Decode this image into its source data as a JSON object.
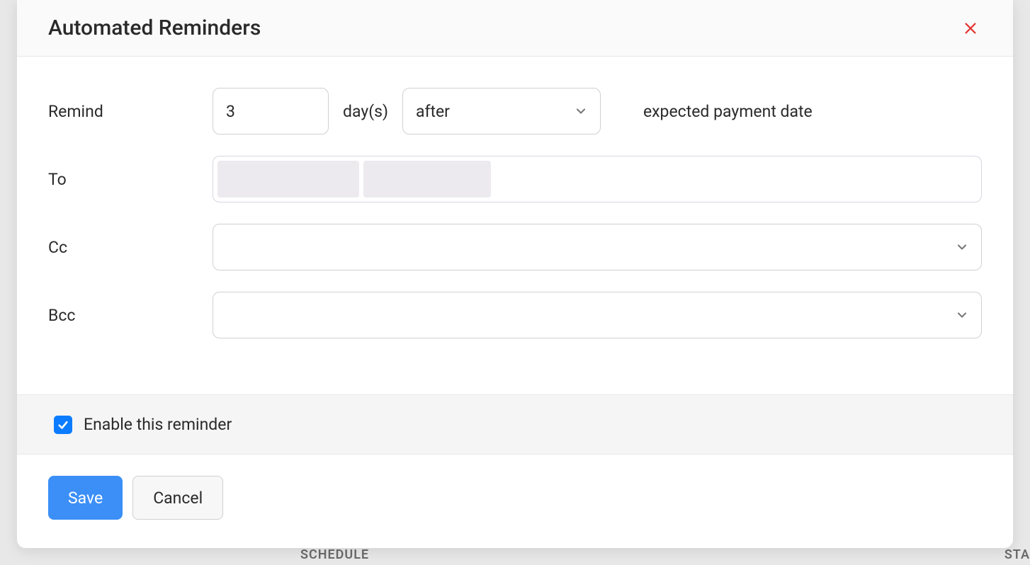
{
  "modal": {
    "title": "Automated Reminders",
    "close_icon": "close-icon"
  },
  "form": {
    "remind_label": "Remind",
    "remind_value": "3",
    "days_label": "day(s)",
    "when_value": "after",
    "expected_label": "expected payment date",
    "to_label": "To",
    "cc_label": "Cc",
    "bcc_label": "Bcc"
  },
  "enable": {
    "checked": true,
    "label": "Enable this reminder"
  },
  "footer": {
    "save_label": "Save",
    "cancel_label": "Cancel"
  },
  "background": {
    "schedule_label": "SCHEDULE",
    "sta_label": "STA"
  }
}
